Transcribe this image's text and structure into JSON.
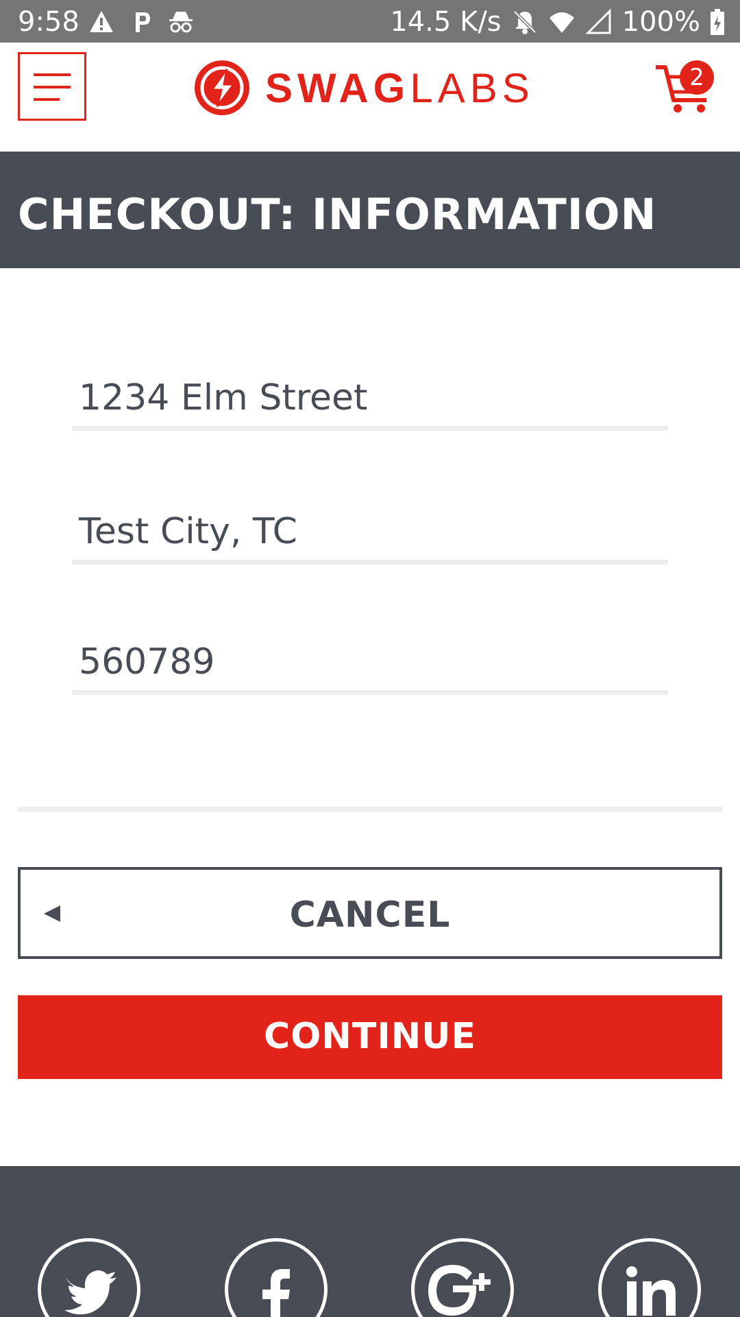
{
  "status_bar": {
    "time": "9:58",
    "network_speed": "14.5 K/s",
    "battery": "100%",
    "icons": [
      "warning-icon",
      "parking-icon",
      "incognito-icon",
      "bell-off-icon",
      "wifi-icon",
      "signal-icon",
      "battery-charging-icon"
    ]
  },
  "header": {
    "brand_swag": "SWAG",
    "brand_labs": "LABS",
    "cart_count": "2"
  },
  "page": {
    "title": "CHECKOUT: INFORMATION"
  },
  "form": {
    "fields": [
      {
        "value": "1234 Elm Street"
      },
      {
        "value": "Test City, TC"
      },
      {
        "value": "560789"
      }
    ]
  },
  "buttons": {
    "cancel_label": "CANCEL",
    "continue_label": "CONTINUE"
  },
  "footer": {
    "social_icons": [
      "twitter-icon",
      "facebook-icon",
      "google-plus-icon",
      "linkedin-icon"
    ]
  },
  "colors": {
    "brand_red": "#e2231a",
    "dark_gray": "#484c55",
    "status_bar": "#757575",
    "underline": "#ededed"
  }
}
